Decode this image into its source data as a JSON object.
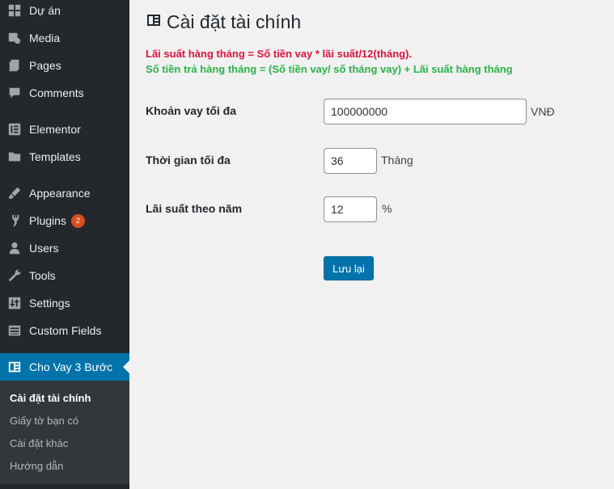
{
  "sidebar": {
    "items": [
      {
        "label": "Dự án",
        "icon": "dashboard-icon"
      },
      {
        "label": "Media",
        "icon": "media-icon"
      },
      {
        "label": "Pages",
        "icon": "pages-icon"
      },
      {
        "label": "Comments",
        "icon": "comments-icon"
      },
      {
        "label": "Elementor",
        "icon": "elementor-icon"
      },
      {
        "label": "Templates",
        "icon": "folder-icon"
      },
      {
        "label": "Appearance",
        "icon": "appearance-icon"
      },
      {
        "label": "Plugins",
        "icon": "plugins-icon",
        "badge": "2"
      },
      {
        "label": "Users",
        "icon": "users-icon"
      },
      {
        "label": "Tools",
        "icon": "tools-icon"
      },
      {
        "label": "Settings",
        "icon": "settings-icon"
      },
      {
        "label": "Custom Fields",
        "icon": "table-icon"
      },
      {
        "label": "Cho Vay 3 Bước",
        "icon": "book-icon",
        "active": true
      }
    ],
    "submenu": [
      {
        "label": "Cài đặt tài chính",
        "current": true
      },
      {
        "label": "Giấy tờ bạn có"
      },
      {
        "label": "Cài đặt khác"
      },
      {
        "label": "Hướng dẫn"
      }
    ]
  },
  "page": {
    "title": "Cài đặt tài chính",
    "note_interest": "Lãi suất hàng tháng = Số tiền vay * lãi suất/12(tháng).",
    "note_payment": "Số tiền trả hàng tháng = (Số tiền vay/ số tháng vay) + Lãi suất hàng tháng"
  },
  "form": {
    "max_loan": {
      "label": "Khoản vay tối đa",
      "value": "100000000",
      "unit": "VNĐ"
    },
    "max_term": {
      "label": "Thời gian tối đa",
      "value": "36",
      "unit": "Tháng"
    },
    "annual_rate": {
      "label": "Lãi suất theo năm",
      "value": "12",
      "unit": "%"
    },
    "save_label": "Lưu lại"
  },
  "colors": {
    "sidebar_bg": "#23282d",
    "accent": "#0073aa",
    "note_red": "#dc143c",
    "note_green": "#2ab34a",
    "badge": "#d54e21"
  }
}
